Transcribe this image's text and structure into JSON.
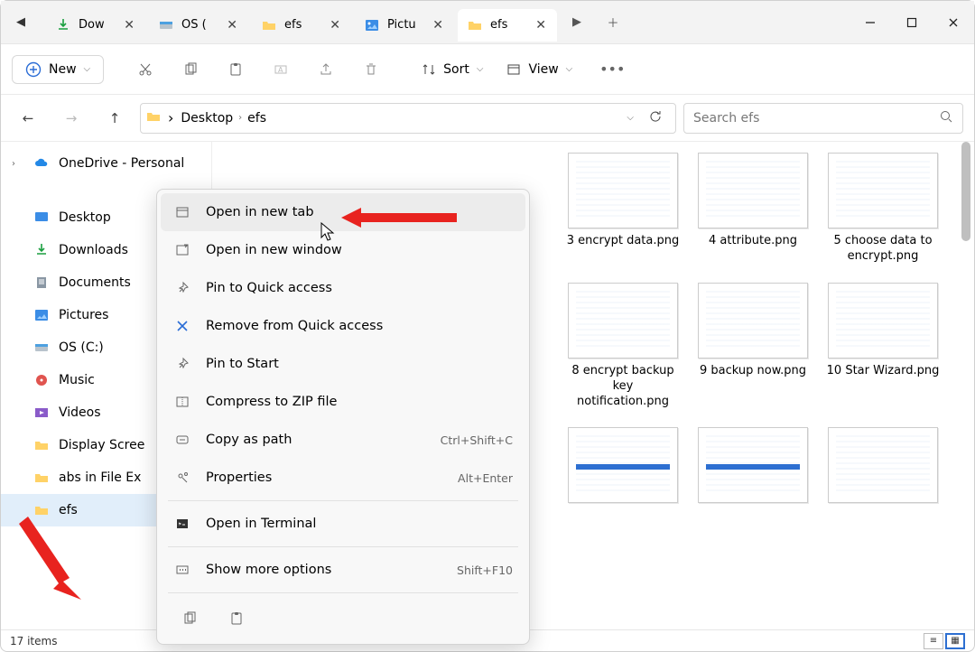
{
  "tabs": [
    {
      "label": "Dow",
      "icon": "download",
      "active": false
    },
    {
      "label": "OS (",
      "icon": "drive",
      "active": false
    },
    {
      "label": "efs",
      "icon": "folder",
      "active": false
    },
    {
      "label": "Pictu",
      "icon": "picture",
      "active": false
    },
    {
      "label": "efs",
      "icon": "folder",
      "active": true
    }
  ],
  "toolbar": {
    "new_label": "New",
    "sort_label": "Sort",
    "view_label": "View"
  },
  "breadcrumbs": [
    "Desktop",
    "efs"
  ],
  "search_placeholder": "Search efs",
  "sidebar": {
    "onedrive": "OneDrive - Personal",
    "items": [
      {
        "label": "Desktop",
        "icon": "desktop-blue"
      },
      {
        "label": "Downloads",
        "icon": "download"
      },
      {
        "label": "Documents",
        "icon": "document"
      },
      {
        "label": "Pictures",
        "icon": "picture"
      },
      {
        "label": "OS (C:)",
        "icon": "drive"
      },
      {
        "label": "Music",
        "icon": "music"
      },
      {
        "label": "Videos",
        "icon": "video"
      },
      {
        "label": "Display Scree",
        "icon": "folder"
      },
      {
        "label": "abs in File Ex",
        "icon": "folder"
      },
      {
        "label": "efs",
        "icon": "folder",
        "selected": true
      }
    ]
  },
  "context_menu": {
    "items": [
      {
        "label": "Open in new tab",
        "icon": "open-tab",
        "highlight": true
      },
      {
        "label": "Open in new window",
        "icon": "open-window"
      },
      {
        "label": "Pin to Quick access",
        "icon": "pin"
      },
      {
        "label": "Remove from Quick access",
        "icon": "remove"
      },
      {
        "label": "Pin to Start",
        "icon": "pin-start"
      },
      {
        "label": "Compress to ZIP file",
        "icon": "zip"
      },
      {
        "label": "Copy as path",
        "icon": "copy-path",
        "shortcut": "Ctrl+Shift+C"
      },
      {
        "label": "Properties",
        "icon": "properties",
        "shortcut": "Alt+Enter"
      },
      {
        "sep": true
      },
      {
        "label": "Open in Terminal",
        "icon": "terminal"
      },
      {
        "sep": true
      },
      {
        "label": "Show more options",
        "icon": "more",
        "shortcut": "Shift+F10"
      }
    ]
  },
  "files": [
    {
      "label": "3 encrypt data.png"
    },
    {
      "label": "4 attribute.png"
    },
    {
      "label": "5 choose data to encrypt.png"
    },
    {
      "label": "8 encrypt backup key notification.png"
    },
    {
      "label": "9 backup now.png"
    },
    {
      "label": "10 Star Wizard.png"
    },
    {
      "label": "",
      "bluebar": true
    },
    {
      "label": "",
      "bluebar": true
    },
    {
      "label": ""
    }
  ],
  "status": {
    "count": "17 items"
  }
}
